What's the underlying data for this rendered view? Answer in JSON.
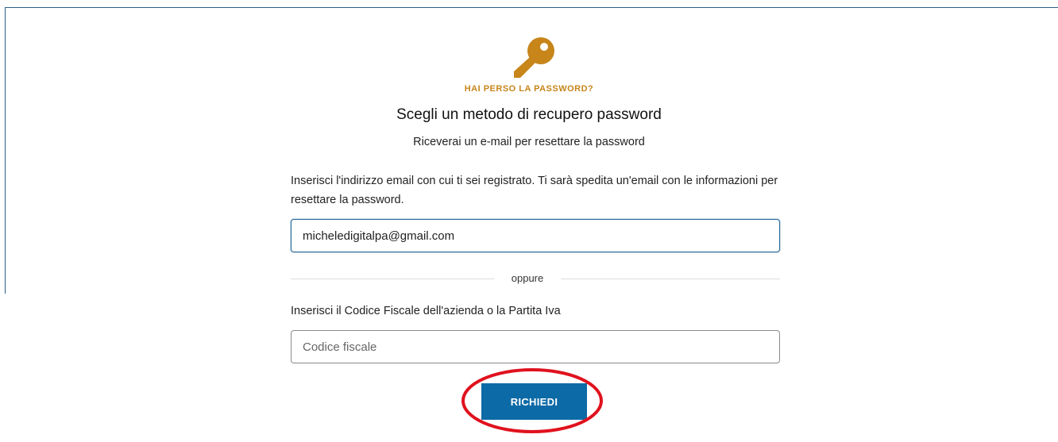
{
  "header": {
    "icon": "key-icon",
    "icon_color": "#c7851a",
    "eyebrow": "HAI PERSO LA PASSWORD?",
    "title": "Scegli un metodo di recupero password",
    "subtitle": "Riceverai un e-mail per resettare la password"
  },
  "email_section": {
    "instructions": "Inserisci l'indirizzo email con cui ti sei registrato. Ti sarà spedita un'email con le informazioni per resettare la password.",
    "email_value": "micheledigitalpa@gmail.com"
  },
  "divider": {
    "label": "oppure"
  },
  "fiscal_section": {
    "label": "Inserisci il Codice Fiscale dell'azienda o la Partita Iva",
    "placeholder": "Codice fiscale"
  },
  "actions": {
    "submit_label": "RICHIEDI"
  },
  "colors": {
    "accent": "#0c6aa6",
    "eyebrow": "#c7851a",
    "annotation": "#e0121e"
  }
}
